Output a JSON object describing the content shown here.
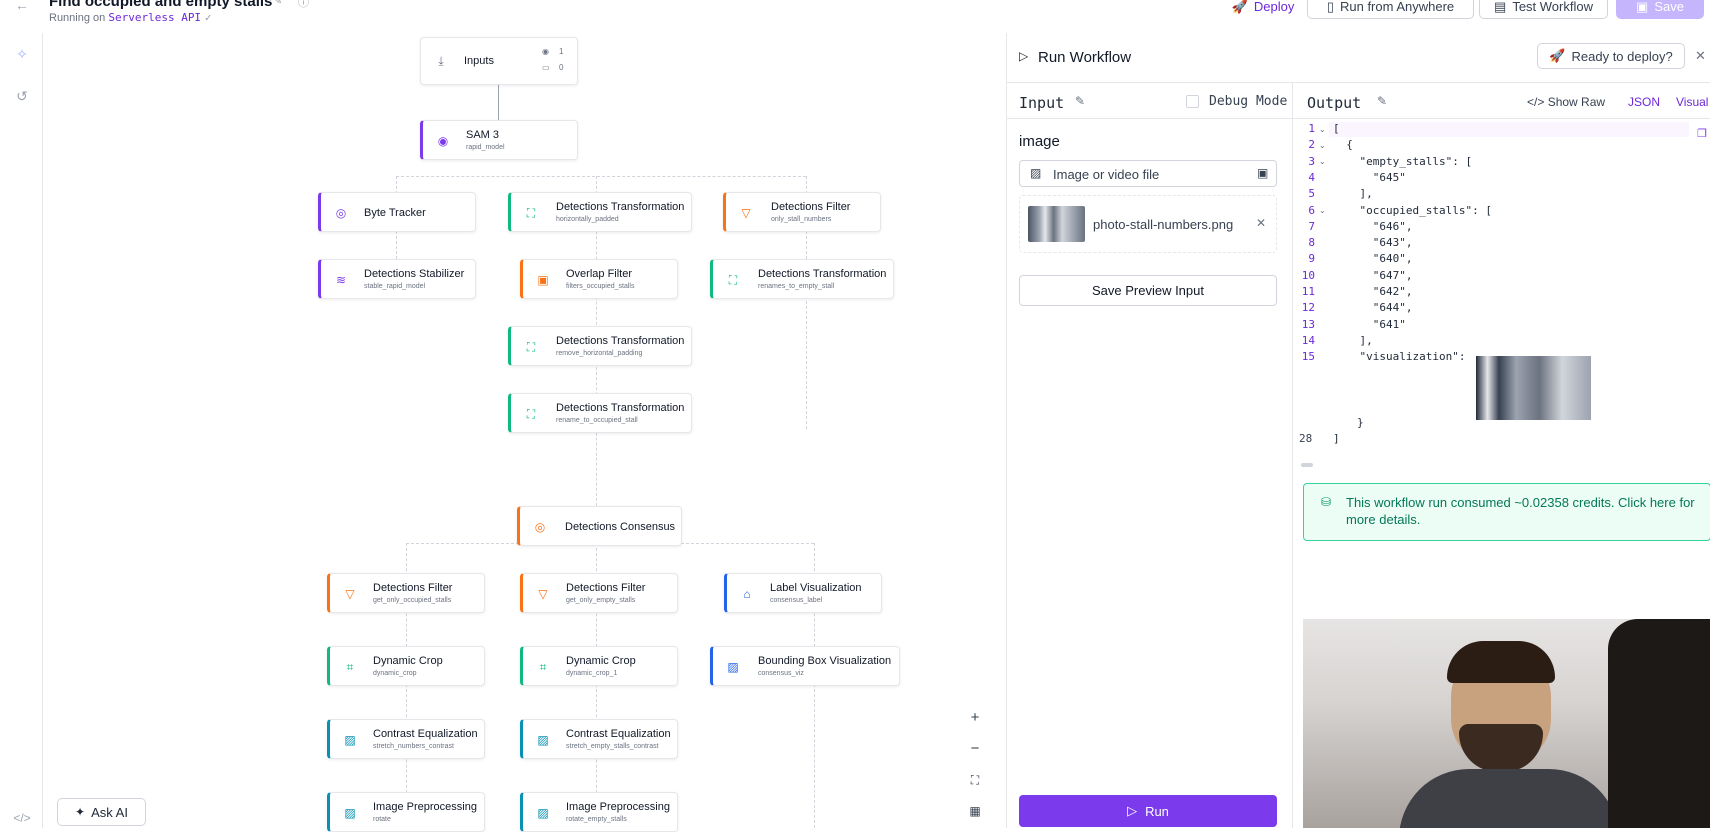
{
  "header": {
    "title": "Find occupied and empty stalls",
    "subtitle_prefix": "Running on",
    "subtitle_api": "Serverless API",
    "buttons": {
      "deploy": "Deploy",
      "run_anywhere": "Run from Anywhere",
      "test_workflow": "Test Workflow",
      "save": "Save"
    }
  },
  "canvas": {
    "inputs_node": {
      "label": "Inputs",
      "count_a": "1",
      "count_b": "0"
    },
    "nodes": [
      {
        "title": "SAM 3",
        "sub": "rapid_model"
      },
      {
        "title": "Byte Tracker",
        "sub": ""
      },
      {
        "title": "Detections Transformation",
        "sub": "horizontally_padded"
      },
      {
        "title": "Detections Filter",
        "sub": "only_stall_numbers"
      },
      {
        "title": "Detections Stabilizer",
        "sub": "stable_rapid_model"
      },
      {
        "title": "Overlap Filter",
        "sub": "filters_occupied_stalls"
      },
      {
        "title": "Detections Transformation",
        "sub": "renames_to_empty_stall"
      },
      {
        "title": "Detections Transformation",
        "sub": "remove_horizontal_padding"
      },
      {
        "title": "Detections Transformation",
        "sub": "rename_to_occupied_stall"
      },
      {
        "title": "Detections Consensus",
        "sub": ""
      },
      {
        "title": "Detections Filter",
        "sub": "get_only_occupied_stalls"
      },
      {
        "title": "Detections Filter",
        "sub": "get_only_empty_stalls"
      },
      {
        "title": "Label Visualization",
        "sub": "consensus_label"
      },
      {
        "title": "Dynamic Crop",
        "sub": "dynamic_crop"
      },
      {
        "title": "Dynamic Crop",
        "sub": "dynamic_crop_1"
      },
      {
        "title": "Bounding Box Visualization",
        "sub": "consensus_viz"
      },
      {
        "title": "Contrast Equalization",
        "sub": "stretch_numbers_contrast"
      },
      {
        "title": "Contrast Equalization",
        "sub": "stretch_empty_stalls_contrast"
      },
      {
        "title": "Image Preprocessing",
        "sub": "rotate"
      },
      {
        "title": "Image Preprocessing",
        "sub": "rotate_empty_stalls"
      }
    ],
    "ask_ai": "Ask AI"
  },
  "run_panel": {
    "title": "Run Workflow",
    "ready_button": "Ready to deploy?",
    "input": {
      "heading": "Input",
      "debug_mode": "Debug Mode",
      "field_label": "image",
      "upload_button": "Image or video file",
      "file_name": "photo-stall-numbers.png",
      "save_preview": "Save Preview Input",
      "run_button": "Run"
    },
    "output": {
      "heading": "Output",
      "show_raw": "Show Raw",
      "tab_json": "JSON",
      "tab_visual": "Visual",
      "code_lines": [
        {
          "n": "1",
          "t": "["
        },
        {
          "n": "2",
          "t": "  {"
        },
        {
          "n": "3",
          "t": "    \"empty_stalls\": ["
        },
        {
          "n": "4",
          "t": "      \"645\""
        },
        {
          "n": "5",
          "t": "    ],"
        },
        {
          "n": "6",
          "t": "    \"occupied_stalls\": ["
        },
        {
          "n": "7",
          "t": "      \"646\","
        },
        {
          "n": "8",
          "t": "      \"643\","
        },
        {
          "n": "9",
          "t": "      \"640\","
        },
        {
          "n": "10",
          "t": "      \"647\","
        },
        {
          "n": "11",
          "t": "      \"642\","
        },
        {
          "n": "12",
          "t": "      \"644\","
        },
        {
          "n": "13",
          "t": "      \"641\""
        },
        {
          "n": "14",
          "t": "    ],"
        },
        {
          "n": "15",
          "t": "    \"visualization\":"
        }
      ],
      "close_brace": "}",
      "last_line_no": "28",
      "last_line": "]",
      "credits_notice": "This workflow run consumed ~0.02358 credits. Click here for more details."
    }
  },
  "colors": {
    "accent": "#6d28d9",
    "run": "#7c3aed",
    "success_bg": "#ecfdf5",
    "success_border": "#34d399"
  }
}
